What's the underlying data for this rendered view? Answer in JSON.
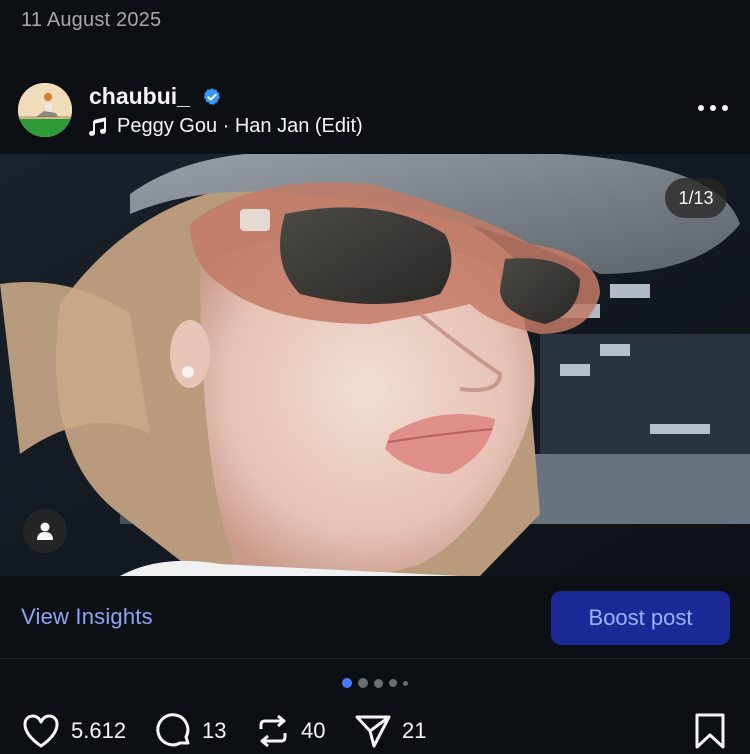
{
  "post": {
    "date": "11 August 2025",
    "username": "chaubui_",
    "verified": true,
    "music": "Peggy Gou · Han Jan (Edit)",
    "more_icon": "more-horizontal-icon",
    "carousel": {
      "position_text": "1/13",
      "current": 1,
      "total": 13
    },
    "image_description": "selfie-sunglasses-cap"
  },
  "actions": {
    "insights_label": "View Insights",
    "boost_label": "Boost post"
  },
  "engagement": {
    "likes": "5.612",
    "comments": "13",
    "reposts": "40",
    "shares": "21"
  },
  "icons": {
    "like": "heart-icon",
    "comment": "comment-bubble-icon",
    "repost": "repost-arrows-icon",
    "share": "send-paper-plane-icon",
    "save": "bookmark-icon",
    "tag": "person-tag-icon",
    "music": "music-note-icon",
    "verified": "verified-badge-icon"
  },
  "colors": {
    "background": "#0c1014",
    "link": "#8ea4f5",
    "boost_bg": "#1b2a96",
    "boost_text": "#9fb2ff",
    "verified": "#3897f0",
    "active_dot": "#4a78ff"
  }
}
